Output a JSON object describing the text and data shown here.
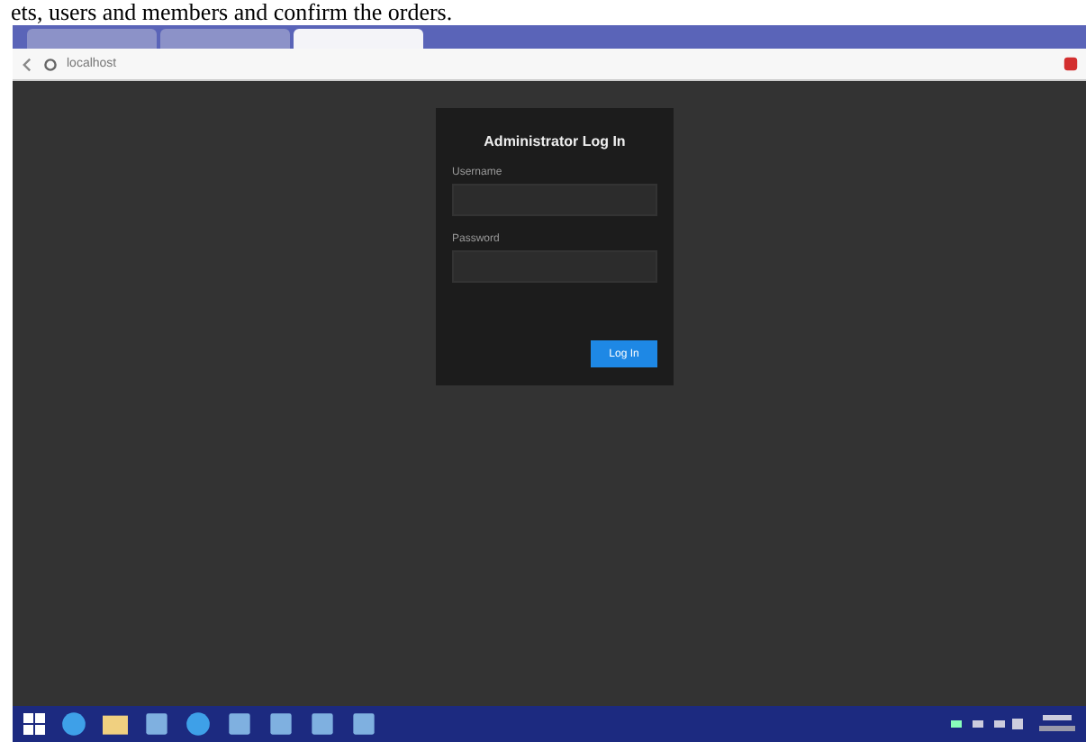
{
  "caption": "ets, users and members and confirm the orders.",
  "browser": {
    "tabs": [
      {
        "selected": false
      },
      {
        "selected": false
      },
      {
        "selected": true
      }
    ],
    "address": "localhost"
  },
  "dialog": {
    "title": "Administrator Log In",
    "fields": [
      {
        "label": "Username"
      },
      {
        "label": "Password"
      }
    ],
    "button": "Log In"
  },
  "taskbar": {
    "apps": [
      {
        "kind": "start"
      },
      {
        "kind": "browser"
      },
      {
        "kind": "folder"
      },
      {
        "kind": "app"
      },
      {
        "kind": "browser"
      },
      {
        "kind": "app"
      },
      {
        "kind": "app"
      },
      {
        "kind": "app"
      },
      {
        "kind": "app"
      }
    ]
  }
}
